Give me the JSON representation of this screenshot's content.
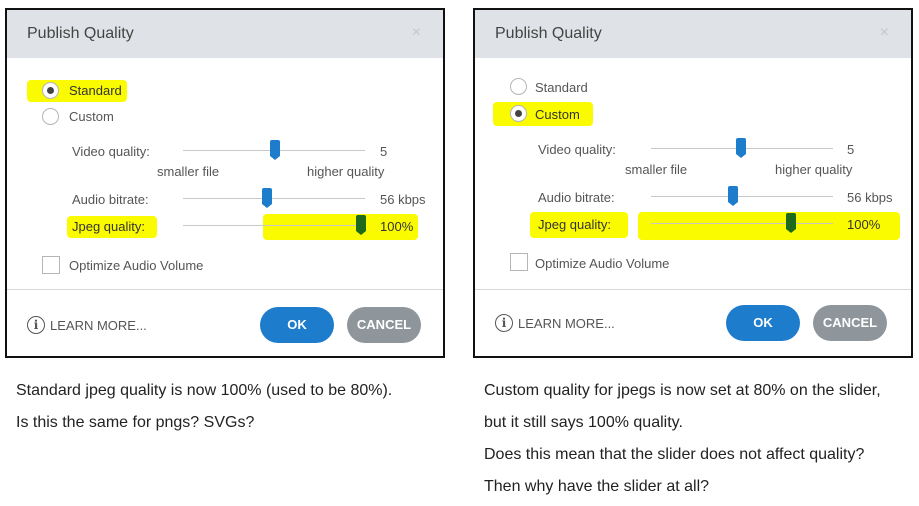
{
  "left_dialog": {
    "title": "Publish Quality",
    "close_glyph": "×",
    "standard_label": "Standard",
    "custom_label": "Custom",
    "video_quality_label": "Video quality:",
    "video_quality_value": "5",
    "smaller_file": "smaller file",
    "higher_quality": "higher quality",
    "audio_bitrate_label": "Audio bitrate:",
    "audio_bitrate_value": "56 kbps",
    "jpeg_quality_label": "Jpeg quality:",
    "jpeg_quality_value": "100%",
    "optimize_audio_label": "Optimize Audio Volume",
    "learn_more": "LEARN MORE...",
    "info_glyph": "i",
    "ok": "OK",
    "cancel": "CANCEL"
  },
  "right_dialog": {
    "title": "Publish Quality",
    "close_glyph": "×",
    "standard_label": "Standard",
    "custom_label": "Custom",
    "video_quality_label": "Video quality:",
    "video_quality_value": "5",
    "smaller_file": "smaller file",
    "higher_quality": "higher quality",
    "audio_bitrate_label": "Audio bitrate:",
    "audio_bitrate_value": "56 kbps",
    "jpeg_quality_label": "Jpeg quality:",
    "jpeg_quality_value": "100%",
    "optimize_audio_label": "Optimize Audio Volume",
    "learn_more": "LEARN MORE...",
    "info_glyph": "i",
    "ok": "OK",
    "cancel": "CANCEL"
  },
  "captions": {
    "left": [
      "Standard jpeg quality is now 100% (used to be 80%).",
      "Is this the same for pngs? SVGs?"
    ],
    "right": [
      "Custom quality for jpegs is now set at 80% on the slider,",
      "but it still says 100% quality.",
      "Does this mean that the slider does not affect quality?",
      "Then why have the slider at all?"
    ]
  },
  "colors": {
    "highlight": "#fbfb00",
    "primary_button": "#1e7ccd",
    "secondary_button": "#8e969b",
    "slider_thumb": "#1e7ccd",
    "jpeg_thumb": "#1d6a1d",
    "title_bar": "#dfe3e7"
  },
  "icons": [
    "close-icon",
    "info-icon",
    "radio-selected-icon",
    "radio-empty-icon",
    "checkbox-icon"
  ]
}
